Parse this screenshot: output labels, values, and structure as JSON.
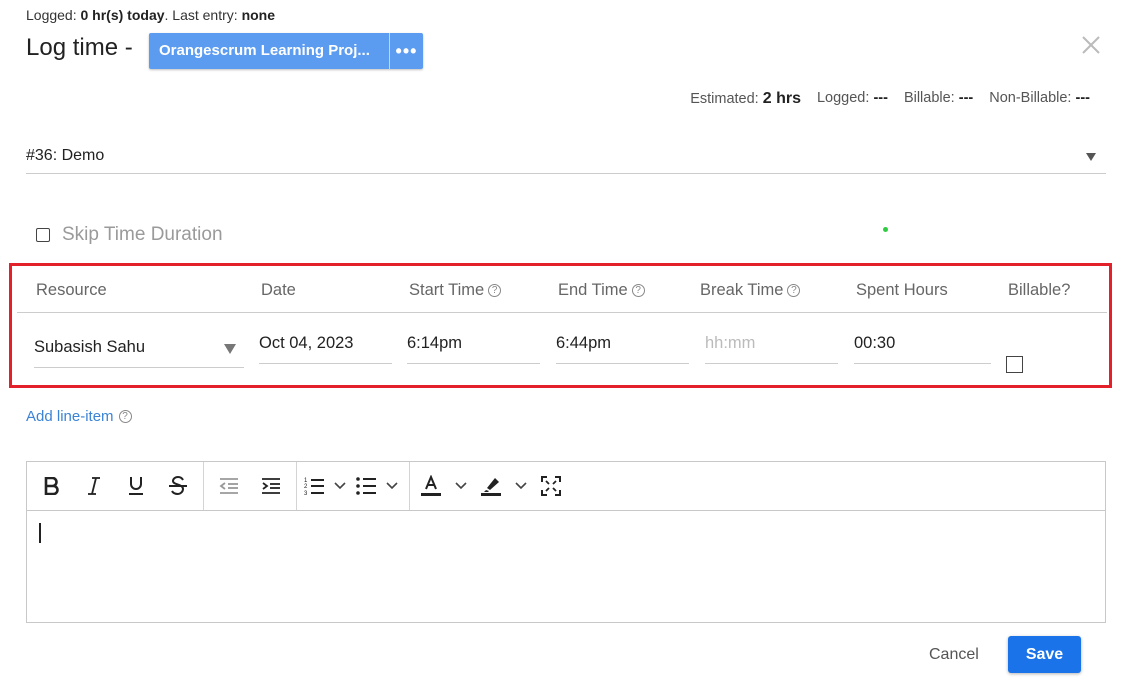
{
  "header": {
    "logged_label": "Logged:",
    "logged_value": "0 hr(s) today",
    "last_entry_label": ". Last entry:",
    "last_entry_value": "none",
    "title": "Log time -",
    "project_name": "Orangescrum Learning Proj...",
    "more_label": "•••"
  },
  "stats": {
    "estimated_label": "Estimated:",
    "estimated_value": "2 hrs",
    "logged_label": "Logged:",
    "logged_value": "---",
    "billable_label": "Billable:",
    "billable_value": "---",
    "nonbillable_label": "Non-Billable:",
    "nonbillable_value": "---"
  },
  "task": {
    "selected": "#36: Demo"
  },
  "skip": {
    "label": "Skip Time Duration",
    "checked": false
  },
  "table": {
    "headers": {
      "resource": "Resource",
      "date": "Date",
      "start": "Start Time",
      "end": "End Time",
      "break": "Break Time",
      "spent": "Spent Hours",
      "billable": "Billable?"
    },
    "row": {
      "resource": "Subasish Sahu",
      "date": "Oct 04, 2023",
      "start": "6:14pm",
      "end": "6:44pm",
      "break_placeholder": "hh:mm",
      "spent": "00:30",
      "billable": false
    }
  },
  "add_line_item": "Add line-item",
  "editor": {
    "tools": [
      "bold-icon",
      "italic-icon",
      "underline-icon",
      "strikethrough-icon",
      "outdent-icon",
      "indent-icon",
      "ordered-list-icon",
      "bullet-list-icon",
      "text-color-icon",
      "highlight-icon",
      "fullscreen-icon"
    ],
    "content": ""
  },
  "footer": {
    "cancel": "Cancel",
    "save": "Save"
  },
  "colors": {
    "accent": "#1a73e8",
    "project_btn": "#5b9bf0",
    "highlight_border": "#e3212b",
    "link": "#3b83d6"
  }
}
